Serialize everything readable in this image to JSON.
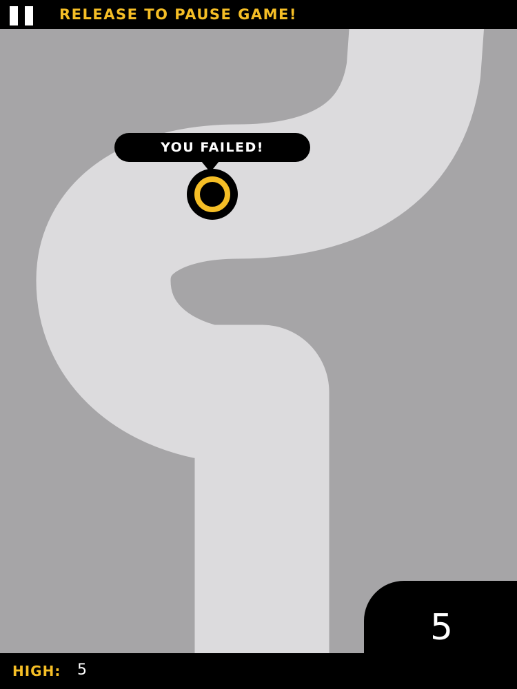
{
  "header": {
    "pause_icon": "pause-icon",
    "message": "RELEASE TO PAUSE GAME!"
  },
  "game": {
    "popup_text": "YOU FAILED!",
    "score": "5"
  },
  "footer": {
    "high_label": "HIGH:",
    "high_value": "5"
  },
  "colors": {
    "accent": "#f5be26",
    "background": "#a6a5a7",
    "track": "#dcdbdd",
    "bars": "#000000"
  }
}
